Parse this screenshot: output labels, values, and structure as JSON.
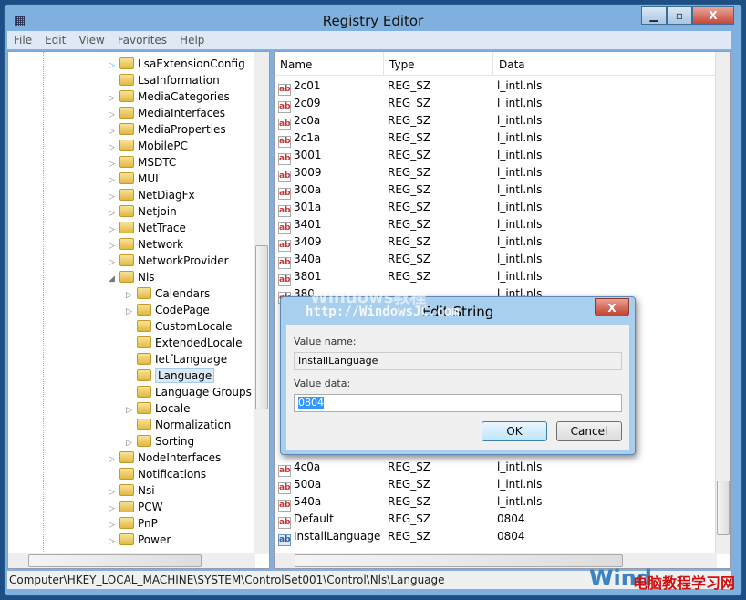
{
  "window": {
    "title": "Registry Editor",
    "icon": "regedit-icon"
  },
  "menu": [
    "File",
    "Edit",
    "View",
    "Favorites",
    "Help"
  ],
  "tree": [
    {
      "label": "LsaExtensionConfig",
      "level": 1,
      "expander": "collapsed"
    },
    {
      "label": "LsaInformation",
      "level": 1,
      "expander": "none"
    },
    {
      "label": "MediaCategories",
      "level": 1,
      "expander": "collapsed"
    },
    {
      "label": "MediaInterfaces",
      "level": 1,
      "expander": "collapsed"
    },
    {
      "label": "MediaProperties",
      "level": 1,
      "expander": "collapsed"
    },
    {
      "label": "MobilePC",
      "level": 1,
      "expander": "collapsed"
    },
    {
      "label": "MSDTC",
      "level": 1,
      "expander": "collapsed"
    },
    {
      "label": "MUI",
      "level": 1,
      "expander": "collapsed"
    },
    {
      "label": "NetDiagFx",
      "level": 1,
      "expander": "collapsed"
    },
    {
      "label": "Netjoin",
      "level": 1,
      "expander": "collapsed"
    },
    {
      "label": "NetTrace",
      "level": 1,
      "expander": "collapsed"
    },
    {
      "label": "Network",
      "level": 1,
      "expander": "collapsed"
    },
    {
      "label": "NetworkProvider",
      "level": 1,
      "expander": "collapsed"
    },
    {
      "label": "Nls",
      "level": 1,
      "expander": "expanded"
    },
    {
      "label": "Calendars",
      "level": 2,
      "expander": "collapsed"
    },
    {
      "label": "CodePage",
      "level": 2,
      "expander": "collapsed"
    },
    {
      "label": "CustomLocale",
      "level": 2,
      "expander": "none"
    },
    {
      "label": "ExtendedLocale",
      "level": 2,
      "expander": "none"
    },
    {
      "label": "IetfLanguage",
      "level": 2,
      "expander": "none"
    },
    {
      "label": "Language",
      "level": 2,
      "expander": "none",
      "selected": true
    },
    {
      "label": "Language Groups",
      "level": 2,
      "expander": "none"
    },
    {
      "label": "Locale",
      "level": 2,
      "expander": "collapsed"
    },
    {
      "label": "Normalization",
      "level": 2,
      "expander": "none"
    },
    {
      "label": "Sorting",
      "level": 2,
      "expander": "collapsed"
    },
    {
      "label": "NodeInterfaces",
      "level": 1,
      "expander": "collapsed"
    },
    {
      "label": "Notifications",
      "level": 1,
      "expander": "none"
    },
    {
      "label": "Nsi",
      "level": 1,
      "expander": "collapsed"
    },
    {
      "label": "PCW",
      "level": 1,
      "expander": "collapsed"
    },
    {
      "label": "PnP",
      "level": 1,
      "expander": "collapsed"
    },
    {
      "label": "Power",
      "level": 1,
      "expander": "collapsed"
    }
  ],
  "columns": [
    "Name",
    "Type",
    "Data"
  ],
  "values_top": [
    {
      "name": "2c01",
      "type": "REG_SZ",
      "data": "l_intl.nls"
    },
    {
      "name": "2c09",
      "type": "REG_SZ",
      "data": "l_intl.nls"
    },
    {
      "name": "2c0a",
      "type": "REG_SZ",
      "data": "l_intl.nls"
    },
    {
      "name": "2c1a",
      "type": "REG_SZ",
      "data": "l_intl.nls"
    },
    {
      "name": "3001",
      "type": "REG_SZ",
      "data": "l_intl.nls"
    },
    {
      "name": "3009",
      "type": "REG_SZ",
      "data": "l_intl.nls"
    },
    {
      "name": "300a",
      "type": "REG_SZ",
      "data": "l_intl.nls"
    },
    {
      "name": "301a",
      "type": "REG_SZ",
      "data": "l_intl.nls"
    },
    {
      "name": "3401",
      "type": "REG_SZ",
      "data": "l_intl.nls"
    },
    {
      "name": "3409",
      "type": "REG_SZ",
      "data": "l_intl.nls"
    },
    {
      "name": "340a",
      "type": "REG_SZ",
      "data": "l_intl.nls"
    },
    {
      "name": "3801",
      "type": "REG_SZ",
      "data": "l_intl.nls"
    },
    {
      "name": "380",
      "type": "",
      "data": "l_intl.nls"
    }
  ],
  "values_bottom": [
    {
      "name": "4c0a",
      "type": "REG_SZ",
      "data": "l_intl.nls"
    },
    {
      "name": "500a",
      "type": "REG_SZ",
      "data": "l_intl.nls"
    },
    {
      "name": "540a",
      "type": "REG_SZ",
      "data": "l_intl.nls"
    },
    {
      "name": "Default",
      "type": "REG_SZ",
      "data": "0804"
    },
    {
      "name": "InstallLanguage",
      "type": "REG_SZ",
      "data": "0804",
      "icon": "binary"
    }
  ],
  "status": "Computer\\HKEY_LOCAL_MACHINE\\SYSTEM\\ControlSet001\\Control\\Nls\\Language",
  "dialog": {
    "title": "Edit String",
    "name_label": "Value name:",
    "name_value": "InstallLanguage",
    "data_label": "Value data:",
    "data_value": "0804",
    "ok": "OK",
    "cancel": "Cancel",
    "close": "X"
  },
  "watermarks": {
    "top": "http://WindowsJC.com",
    "top2": "Windows教程",
    "bottom_a": "Wind",
    "bottom_b": "电脑教程学习网"
  }
}
